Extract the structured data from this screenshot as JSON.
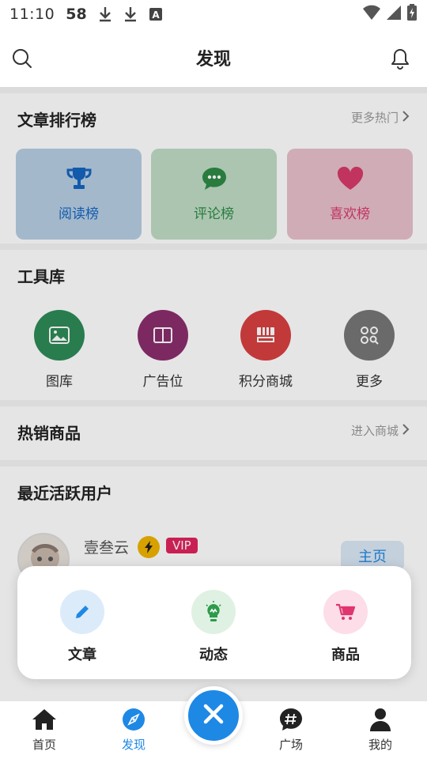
{
  "status_bar": {
    "time": "11:10",
    "number": "58"
  },
  "header": {
    "title": "发现"
  },
  "rankings": {
    "title": "文章排行榜",
    "more_label": "更多热门",
    "cards": [
      {
        "label": "阅读榜",
        "icon": "trophy-icon",
        "color": "#1565c0",
        "bg": "#b6cde2"
      },
      {
        "label": "评论榜",
        "icon": "chat-icon",
        "color": "#2e8b45",
        "bg": "#bfdcc6"
      },
      {
        "label": "喜欢榜",
        "icon": "heart-icon",
        "color": "#d63a6a",
        "bg": "#e8c0cc"
      }
    ]
  },
  "tools": {
    "title": "工具库",
    "items": [
      {
        "label": "图库",
        "icon": "image-icon",
        "color": "#2e8b57"
      },
      {
        "label": "广告位",
        "icon": "book-icon",
        "color": "#8b2e6e"
      },
      {
        "label": "积分商城",
        "icon": "store-icon",
        "color": "#d84040"
      },
      {
        "label": "更多",
        "icon": "grid-icon",
        "color": "#777777"
      }
    ]
  },
  "hot_products": {
    "title": "热销商品",
    "more_label": "进入商城"
  },
  "active_users": {
    "title": "最近活跃用户",
    "users": [
      {
        "name": "壹叁云",
        "badge": "VIP",
        "action_label": "主页"
      }
    ]
  },
  "popup": {
    "items": [
      {
        "label": "文章",
        "icon": "pencil-icon",
        "color": "#1e88e5",
        "bg": "#dcebfa"
      },
      {
        "label": "动态",
        "icon": "bulb-icon",
        "color": "#2e9b4a",
        "bg": "#dff1e2"
      },
      {
        "label": "商品",
        "icon": "cart-icon",
        "color": "#e0356e",
        "bg": "#fcdde8"
      }
    ]
  },
  "bottom_nav": {
    "items": [
      {
        "label": "首页",
        "icon": "home-icon"
      },
      {
        "label": "发现",
        "icon": "compass-icon",
        "active": true
      },
      {
        "label": "广场",
        "icon": "hashtag-icon"
      },
      {
        "label": "我的",
        "icon": "user-icon"
      }
    ],
    "center_icon": "close-icon"
  },
  "colors": {
    "accent": "#1e88e5"
  }
}
